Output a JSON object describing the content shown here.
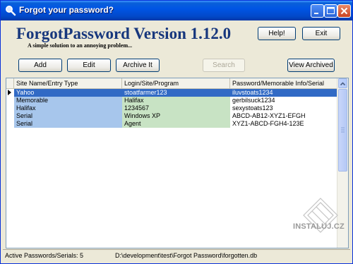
{
  "window": {
    "title": "Forgot your password?",
    "icon": "magnifier-icon"
  },
  "header": {
    "title": "ForgotPassword Version 1.12.0",
    "subtitle": "A simple solution to an annoying problem...",
    "help_label": "Help!",
    "exit_label": "Exit"
  },
  "toolbar": {
    "add_label": "Add",
    "edit_label": "Edit",
    "archive_label": "Archive It",
    "search_label": "Search",
    "view_archived_label": "View Archived"
  },
  "table": {
    "columns": [
      "Site Name/Entry Type",
      "Login/Site/Program",
      "Password/Memorable Info/Serial"
    ],
    "rows": [
      {
        "c1": "Yahoo",
        "c2": "stoatfarmer123",
        "c3": "iluvstoats1234",
        "selected": true
      },
      {
        "c1": "Memorable",
        "c2": "Halifax",
        "c3": "gerbilsuck1234",
        "selected": false
      },
      {
        "c1": "Halifax",
        "c2": "1234567",
        "c3": "sexystoats123",
        "selected": false
      },
      {
        "c1": "Serial",
        "c2": "Windows XP",
        "c3": "ABCD-AB12-XYZ1-EFGH",
        "selected": false
      },
      {
        "c1": "Serial",
        "c2": "Agent",
        "c3": "XYZ1-ABCD-FGH4-123E",
        "selected": false
      }
    ]
  },
  "status": {
    "count_text": "Active Passwords/Serials: 5",
    "path_text": "D:\\development\\test\\Forgot Password\\forgotten.db"
  },
  "watermark": {
    "text": "INSTALUJ.CZ"
  },
  "colors": {
    "title_blue": "#17377d",
    "col1_bg": "#a7c6ec",
    "col2_bg": "#c8e3c4",
    "selection": "#316ac5"
  }
}
